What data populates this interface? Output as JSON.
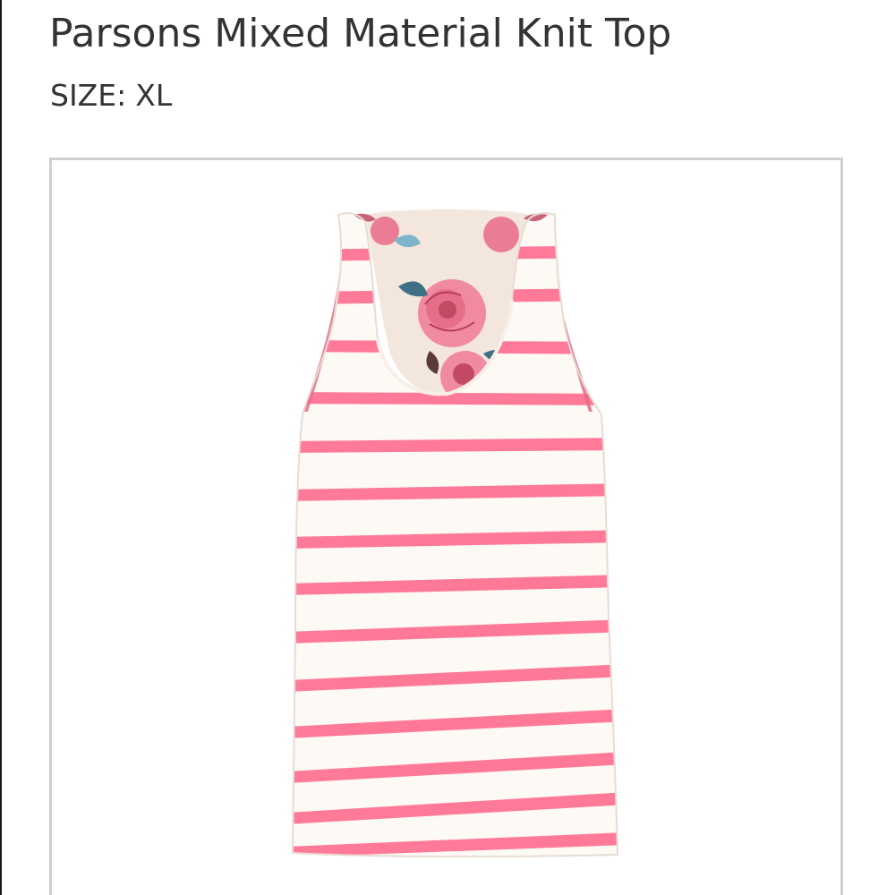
{
  "product": {
    "title": "Parsons Mixed Material Knit Top",
    "size_label": "SIZE:",
    "size_value": "XL"
  },
  "image": {
    "subject": "striped-racerback-tank-icon",
    "colors": {
      "stripe": "#ff6f91",
      "base": "#fdf9f5",
      "floral_back": "#f3e6dc",
      "rose": "#f08aa0",
      "rose_dark": "#c24a63",
      "leaf": "#7fb4c9",
      "leaf_dark": "#3f6f86",
      "card_border": "#cfcfcf",
      "text": "#333333"
    }
  }
}
